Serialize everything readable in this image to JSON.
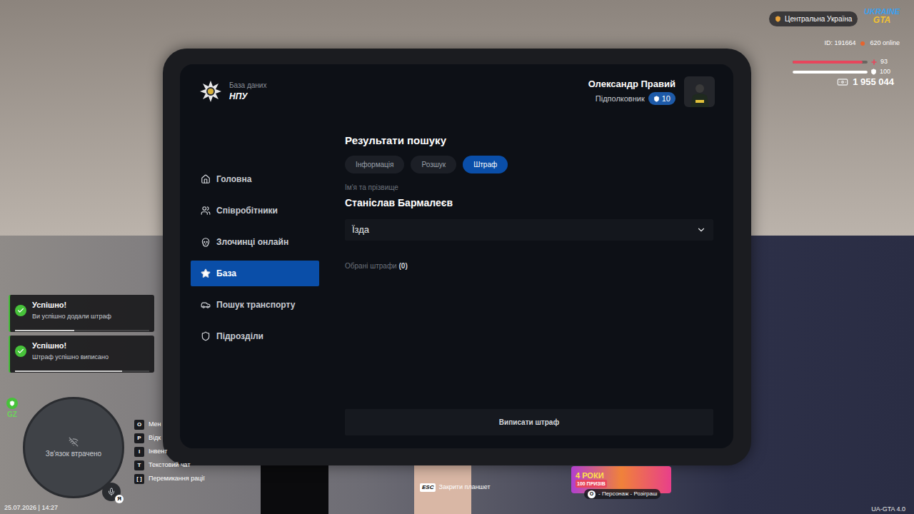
{
  "hud": {
    "region": "Центральна Україна",
    "logo_top": "UKRAINE",
    "logo_bottom": "GTA",
    "id": "ID: 191664",
    "online": "620 online",
    "health": {
      "reading": "93",
      "level": 0.93
    },
    "armor": {
      "reading": "100",
      "level": 1
    },
    "money": "1 955 044",
    "version": "UA-GTA 4.0",
    "datetime": "25.07.2026 | 14:27"
  },
  "notifications": [
    {
      "title": "Успішно!",
      "message": "Ви успішно додали штраф",
      "level": 0.44
    },
    {
      "title": "Успішно!",
      "message": "Штраф успішно виписано",
      "level": 0.8
    }
  ],
  "minimap": {
    "status": "Зв'язок втрачено",
    "zone": "GZ",
    "voice_key": "Я"
  },
  "keybinds": [
    {
      "key": "O",
      "label": "Мен"
    },
    {
      "key": "P",
      "label": "Відк"
    },
    {
      "key": "I",
      "label": "Інвент"
    },
    {
      "key": "T",
      "label": "Текстовий чат"
    },
    {
      "key": "[ ]",
      "label": "Перемикання рації"
    }
  ],
  "close_hint": {
    "key": "ESC",
    "label": "Закрити планшет"
  },
  "promo": {
    "title": "4 РОКИ",
    "subtitle": "100 ПРИЗІВ",
    "key": "O",
    "label": "- Персонаж - Розіграш"
  },
  "tablet": {
    "logo": {
      "caption": "База даних",
      "name": "НПУ"
    },
    "profile": {
      "name": "Олександр Правий",
      "rank": "Підполковник",
      "level": "10"
    },
    "sidebar": [
      {
        "label": "Головна",
        "selected": false
      },
      {
        "label": "Співробітники",
        "selected": false
      },
      {
        "label": "Злочинці онлайн",
        "selected": false
      },
      {
        "label": "База",
        "selected": true
      },
      {
        "label": "Пошук транспорту",
        "selected": false
      },
      {
        "label": "Підрозділи",
        "selected": false
      }
    ],
    "title": "Результати пошуку",
    "tabs": [
      {
        "label": "Інформація",
        "selected": false
      },
      {
        "label": "Розшук",
        "selected": false
      },
      {
        "label": "Штраф",
        "selected": true
      }
    ],
    "name_label": "Ім'я та прізвище",
    "name": "Станіслав Бармалеєв",
    "category": "Їзда",
    "selected_label": "Обрані штрафи",
    "selected_count": "(0)",
    "submit": "Виписати штраф"
  }
}
